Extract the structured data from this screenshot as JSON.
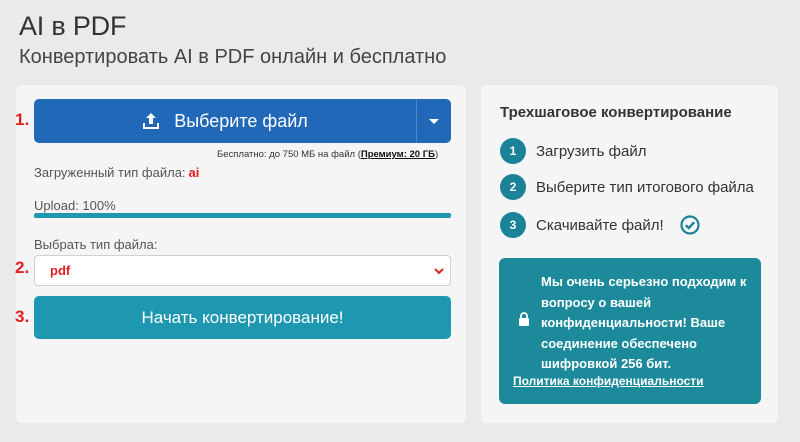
{
  "header": {
    "title": "AI в PDF",
    "subtitle": "Конвертировать AI в PDF онлайн и бесплатно"
  },
  "steps_markers": [
    "1.",
    "2.",
    "3."
  ],
  "upload": {
    "button_label": "Выберите файл",
    "free_note_prefix": "Бесплатно: до 750 МБ на файл (",
    "premium_link": "Премиум: 20 ГБ",
    "free_note_suffix": ")",
    "loaded_type_label": "Загруженный тип файла:",
    "loaded_type_value": "ai",
    "progress_label": "Upload: 100%",
    "progress_fraction": 1.0
  },
  "format": {
    "label": "Выбрать тип файла:",
    "selected": "pdf"
  },
  "convert": {
    "button_label": "Начать конвертирование!"
  },
  "sidebar": {
    "title": "Трехшаговое конвертирование",
    "steps": [
      {
        "num": "1",
        "label": "Загрузить файл"
      },
      {
        "num": "2",
        "label": "Выберите тип итогового файла"
      },
      {
        "num": "3",
        "label": "Скачивайте файл!"
      }
    ],
    "privacy_text": "Мы очень серьезно подходим к вопросу о вашей конфиденциальности! Ваше соединение обеспечено шифровкой 256 бит.",
    "privacy_link": "Политика конфиденциальности"
  },
  "colors": {
    "primary_blue": "#2168b8",
    "teal": "#1e97b0",
    "accent_red": "#e02020"
  },
  "icons": [
    "upload-icon",
    "chevron-down-icon",
    "check-circle-icon",
    "lock-icon"
  ]
}
